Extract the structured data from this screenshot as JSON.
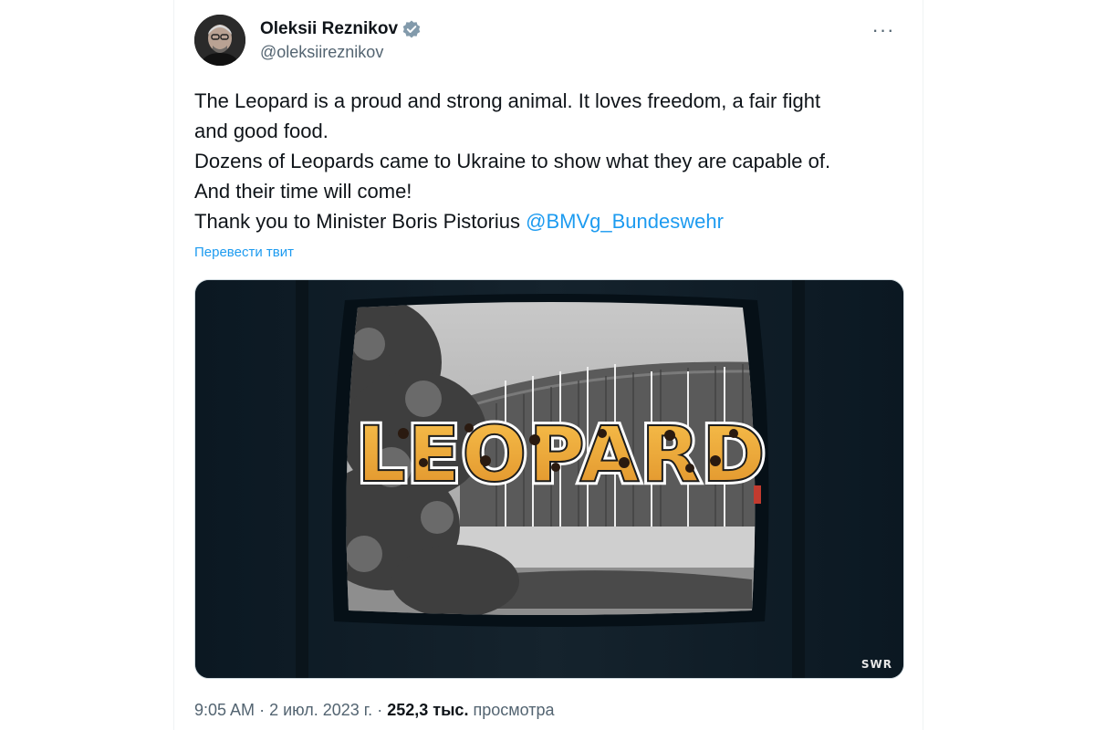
{
  "author": {
    "display_name": "Oleksii Reznikov",
    "handle": "@oleksiireznikov",
    "verified": true,
    "verified_color": "#1d9bf0"
  },
  "header": {
    "more_label": "···"
  },
  "tweet": {
    "lines": [
      "The Leopard is a proud and strong animal. It loves freedom, a fair fight",
      "and good food.",
      "Dozens of Leopards came to Ukraine to show what they are capable of.",
      "And their time will come!"
    ],
    "last_line_prefix": "Thank you to Minister Boris Pistorius ",
    "mention": "@BMVg_Bundeswehr",
    "translate_label": "Перевести твит"
  },
  "media": {
    "title_text": "LEOPARD",
    "watermark": "SWR"
  },
  "meta": {
    "time": "9:05 AM",
    "separator": "·",
    "date": "2 июл. 2023 г.",
    "views_count": "252,3 тыс.",
    "views_label": "просмотра"
  },
  "colors": {
    "accent": "#1d9bf0",
    "text": "#0f1419",
    "secondary": "#536471"
  }
}
